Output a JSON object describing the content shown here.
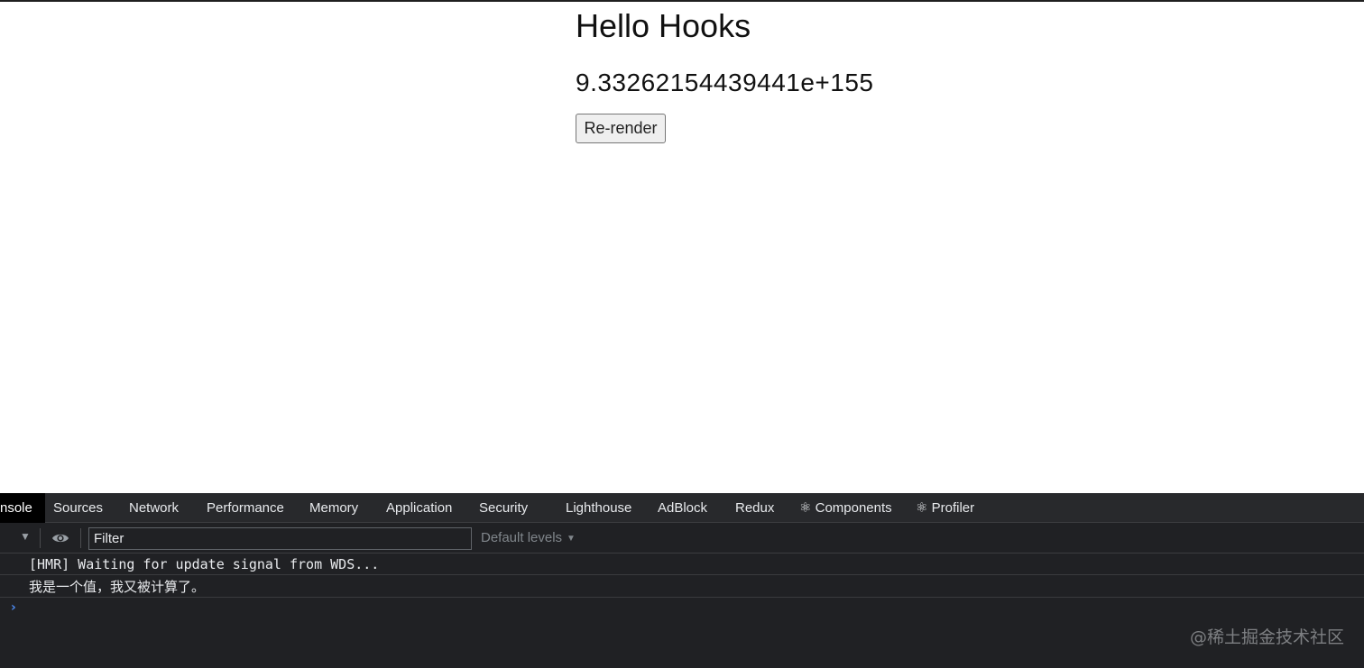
{
  "page": {
    "title": "Hello Hooks",
    "value": "9.33262154439441e+155",
    "button_label": "Re-render"
  },
  "devtools": {
    "tabs": [
      {
        "label": "nsole",
        "active": true
      },
      {
        "label": "Sources"
      },
      {
        "label": "Network"
      },
      {
        "label": "Performance"
      },
      {
        "label": "Memory"
      },
      {
        "label": "Application"
      },
      {
        "label": "Security"
      },
      {
        "label": "Lighthouse"
      },
      {
        "label": "AdBlock"
      },
      {
        "label": "Redux"
      },
      {
        "label": "⚛ Components"
      },
      {
        "label": "⚛ Profiler"
      }
    ],
    "filter_placeholder": "Filter",
    "levels_label": "Default levels",
    "console_lines": [
      "[HMR] Waiting for update signal from WDS...",
      "我是一个值，我又被计算了。"
    ],
    "prompt_symbol": "›"
  },
  "watermark": "@稀土掘金技术社区",
  "icons": {
    "dropdown": "triangle-down-icon",
    "eye": "eye-icon",
    "levels_arrow": "triangle-down-icon",
    "prompt": "chevron-right-icon"
  },
  "colors": {
    "devtools_bg": "#202124",
    "tabbar_bg": "#28292c",
    "active_tab_bg": "#000000",
    "prompt": "#4d8af0"
  }
}
